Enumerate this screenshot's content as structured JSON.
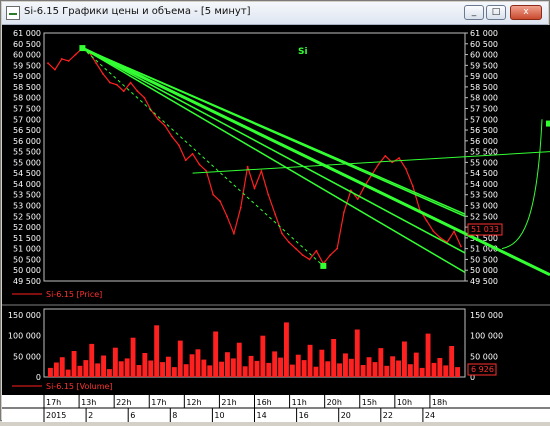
{
  "window": {
    "title": "Si-6.15 Графики цены и объема - [5 минут]",
    "buttons": [
      "_",
      "□",
      "x"
    ]
  },
  "price_panel": {
    "symbol_label": "Si",
    "series_label": "Si-6.15 [Price]",
    "current_value": "51 033",
    "y_ticks": [
      "61 000",
      "60 500",
      "60 000",
      "59 500",
      "59 000",
      "58 500",
      "58 000",
      "57 500",
      "57 000",
      "56 500",
      "56 000",
      "55 500",
      "55 000",
      "54 500",
      "54 000",
      "53 500",
      "53 000",
      "52 500",
      "52 000",
      "51 500",
      "51 000",
      "50 500",
      "50 000",
      "49 500"
    ]
  },
  "volume_panel": {
    "series_label": "Si-6.15 [Volume]",
    "current_value": "6 926",
    "y_ticks": [
      "150 000",
      "100 000",
      "50 000",
      "0"
    ]
  },
  "time_axis": {
    "hour_labels": [
      "17h",
      "13h",
      "22h",
      "17h",
      "12h",
      "21h",
      "16h",
      "11h",
      "20h",
      "15h",
      "10h",
      "18h"
    ],
    "date_labels": [
      "2015",
      "2",
      "6",
      "8",
      "10",
      "14",
      "16",
      "20",
      "22",
      "24"
    ]
  },
  "colors": {
    "background": "#000000",
    "price": "#ff2020",
    "trendline": "#33ff33",
    "marker": "#33ff33",
    "volume": "#ff2020"
  },
  "chart_data": [
    {
      "type": "line",
      "title": "",
      "series_name": "Si-6.15 [Price]",
      "xlabel": "",
      "ylabel": "",
      "ylim": [
        49500,
        61000
      ],
      "x": [
        0,
        1,
        2,
        3,
        4,
        5,
        6,
        7,
        8,
        9,
        10,
        11,
        12,
        13,
        14,
        15,
        16,
        17,
        18,
        19,
        20,
        21,
        22,
        23,
        24,
        25,
        26,
        27,
        28,
        29,
        30,
        31,
        32,
        33,
        34,
        35,
        36,
        37,
        38,
        39,
        40,
        41,
        42,
        43,
        44,
        45,
        46,
        47,
        48,
        49,
        50,
        51,
        52,
        53,
        54,
        55,
        56,
        57,
        58,
        59,
        60
      ],
      "values": [
        59600,
        59300,
        59800,
        59700,
        60000,
        60300,
        60100,
        59600,
        59100,
        58700,
        58600,
        58300,
        58700,
        58300,
        58000,
        57400,
        57000,
        56700,
        56200,
        55800,
        55100,
        55400,
        54900,
        54600,
        53500,
        53200,
        52500,
        51700,
        52900,
        54800,
        53800,
        54600,
        53500,
        52600,
        51700,
        51300,
        51000,
        50700,
        50500,
        50900,
        50300,
        50700,
        51000,
        52700,
        53700,
        53300,
        53900,
        54400,
        54900,
        55300,
        55000,
        55200,
        54700,
        53900,
        52800,
        52300,
        51800,
        51500,
        51300,
        51800,
        51100
      ],
      "grid": false,
      "legend": "none"
    },
    {
      "type": "bar",
      "title": "",
      "series_name": "Si-6.15 [Volume]",
      "xlabel": "",
      "ylabel": "",
      "ylim": [
        0,
        150000
      ],
      "values": [
        22000,
        35000,
        48000,
        18000,
        63000,
        27000,
        41000,
        80000,
        33000,
        52000,
        19000,
        71000,
        38000,
        45000,
        95000,
        29000,
        58000,
        40000,
        125000,
        36000,
        49000,
        24000,
        88000,
        31000,
        55000,
        67000,
        42000,
        28000,
        110000,
        37000,
        60000,
        45000,
        83000,
        26000,
        51000,
        39000,
        100000,
        34000,
        62000,
        47000,
        132000,
        30000,
        54000,
        41000,
        78000,
        25000,
        66000,
        38000,
        92000,
        33000,
        57000,
        44000,
        115000,
        29000,
        48000,
        36000,
        70000,
        27000,
        50000,
        40000,
        86000,
        31000,
        59000,
        22000,
        105000,
        34000,
        46000,
        28000,
        75000,
        24000
      ],
      "grid": false,
      "legend": "none"
    }
  ],
  "trendlines": {
    "count": 5,
    "anchor_high": 60300,
    "anchor_low": 50200
  }
}
